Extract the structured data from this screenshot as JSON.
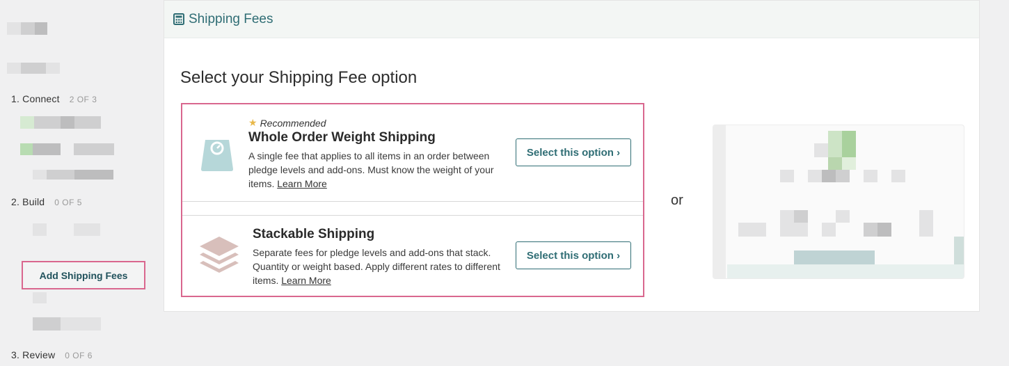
{
  "sidebar": {
    "steps": [
      {
        "label": "1. Connect",
        "count": "2 OF 3"
      },
      {
        "label": "2. Build",
        "count": "0 OF 5"
      },
      {
        "label": "3. Review",
        "count": "0 OF 6"
      }
    ],
    "active_item": "Add Shipping Fees"
  },
  "panel": {
    "header_title": "Shipping Fees",
    "header_icon": "calculator-icon",
    "section_title": "Select your Shipping Fee option",
    "or_text": "or",
    "options": [
      {
        "badge": "Recommended",
        "badge_icon": "sparkle-star-icon",
        "title": "Whole Order Weight Shipping",
        "description": "A single fee that applies to all items in an order between pledge levels and add-ons. Must know the weight of your items.",
        "learn_more": "Learn More",
        "button": "Select this option ›",
        "icon": "weight-scale-icon"
      },
      {
        "title": "Stackable Shipping",
        "description": "Separate fees for pledge levels and add-ons that stack. Quantity or weight based. Apply different rates to different items.",
        "learn_more": "Learn More",
        "button": "Select this option ›",
        "icon": "stacked-layers-icon"
      }
    ]
  },
  "colors": {
    "accent_teal": "#2f6d74",
    "highlight_pink": "#d9678e",
    "weight_icon": "#b6d7d9",
    "stack_icon": "#d8bfbb"
  }
}
